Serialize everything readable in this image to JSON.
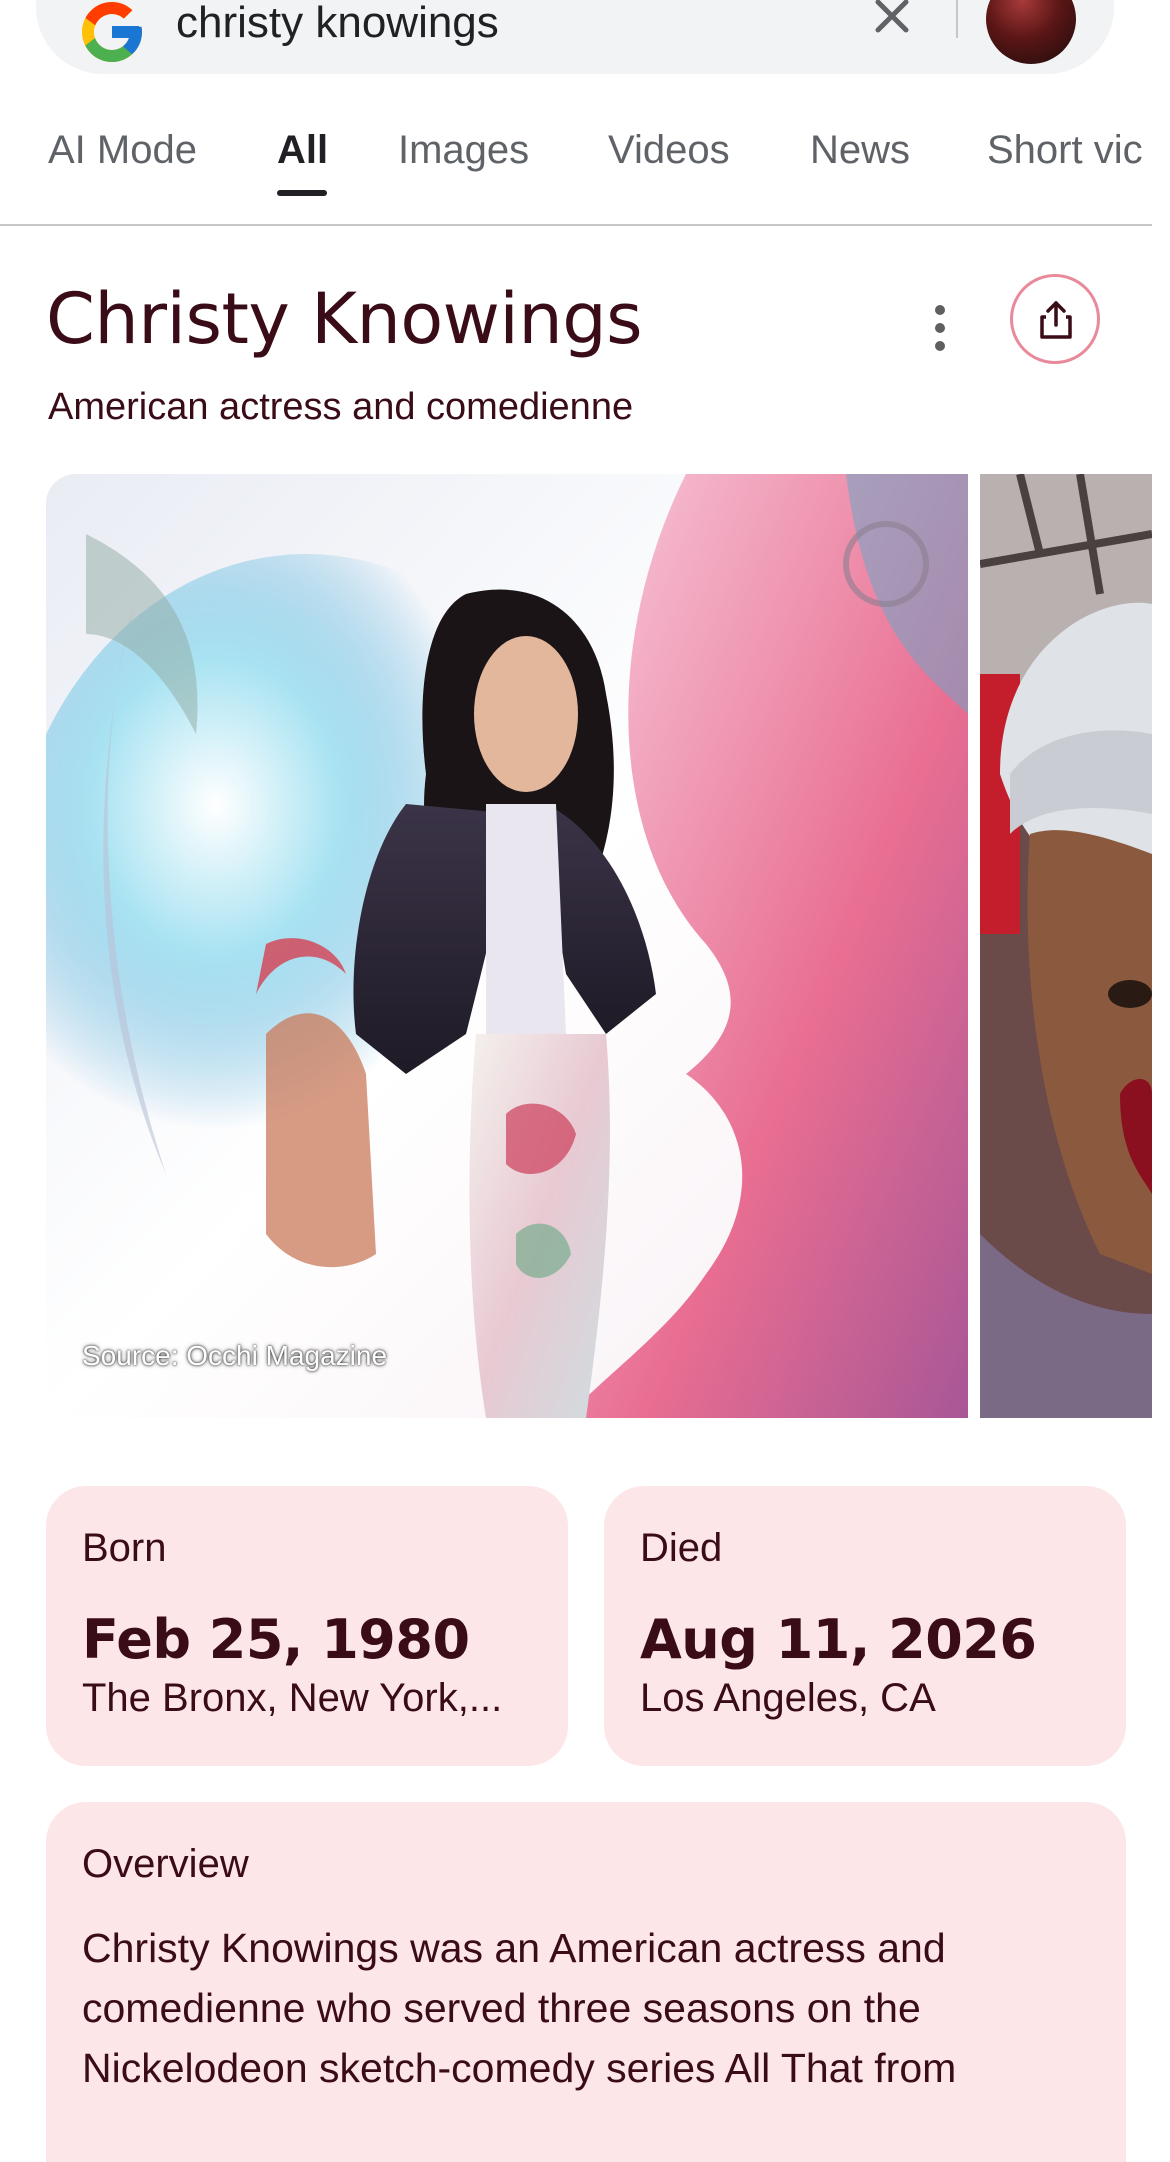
{
  "search": {
    "query": "christy knowings"
  },
  "tabs": [
    {
      "label": "AI Mode",
      "active": false
    },
    {
      "label": "All",
      "active": true
    },
    {
      "label": "Images",
      "active": false
    },
    {
      "label": "Videos",
      "active": false
    },
    {
      "label": "News",
      "active": false
    },
    {
      "label": "Short vic",
      "active": false
    }
  ],
  "knowledge_panel": {
    "title": "Christy Knowings",
    "subtitle": "American actress and comedienne",
    "image_source": "Source: Occhi Magazine",
    "born": {
      "label": "Born",
      "date": "Feb 25, 1980",
      "place": "The Bronx, New York,..."
    },
    "died": {
      "label": "Died",
      "date": "Aug 11, 2026",
      "place": "Los Angeles, CA"
    },
    "overview": {
      "label": "Overview",
      "text": "Christy Knowings was an American actress and comedienne who served three seasons on the Nickelodeon sketch-comedy series All That from"
    }
  },
  "colors": {
    "accent_text": "#3a0c17",
    "card_bg": "#fde6e8",
    "share_ring": "#e88a9a"
  }
}
